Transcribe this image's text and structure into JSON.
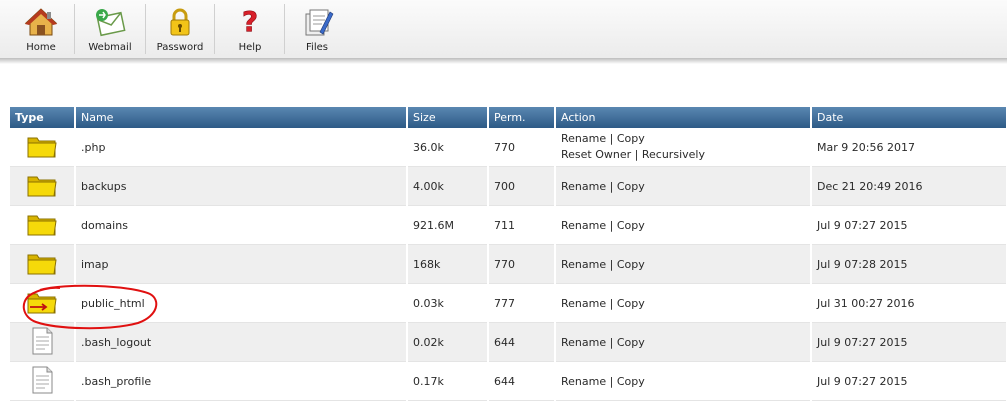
{
  "toolbar": {
    "buttons": [
      {
        "label": "Home",
        "icon": "home-icon"
      },
      {
        "label": "Webmail",
        "icon": "webmail-icon"
      },
      {
        "label": "Password",
        "icon": "lock-icon"
      },
      {
        "label": "Help",
        "icon": "help-icon"
      },
      {
        "label": "Files",
        "icon": "files-icon"
      }
    ]
  },
  "table": {
    "headers": {
      "type": "Type",
      "name": "Name",
      "size": "Size",
      "perm": "Perm.",
      "action": "Action",
      "date": "Date"
    },
    "actions": {
      "rename": "Rename",
      "copy": "Copy",
      "reset_owner": "Reset Owner",
      "recursively": "Recursively",
      "sep": "|"
    },
    "rows": [
      {
        "type": "folder",
        "name": ".php",
        "size": "36.0k",
        "perm": "770",
        "date": "Mar 9 20:56 2017",
        "reset_owner": true
      },
      {
        "type": "folder",
        "name": "backups",
        "size": "4.00k",
        "perm": "700",
        "date": "Dec 21 20:49 2016",
        "reset_owner": false
      },
      {
        "type": "folder",
        "name": "domains",
        "size": "921.6M",
        "perm": "711",
        "date": "Jul 9 07:27 2015",
        "reset_owner": false
      },
      {
        "type": "folder",
        "name": "imap",
        "size": "168k",
        "perm": "770",
        "date": "Jul 9 07:28 2015",
        "reset_owner": false
      },
      {
        "type": "folder-link",
        "name": "public_html",
        "size": "0.03k",
        "perm": "777",
        "date": "Jul 31 00:27 2016",
        "reset_owner": false
      },
      {
        "type": "file",
        "name": ".bash_logout",
        "size": "0.02k",
        "perm": "644",
        "date": "Jul 9 07:27 2015",
        "reset_owner": false
      },
      {
        "type": "file",
        "name": ".bash_profile",
        "size": "0.17k",
        "perm": "644",
        "date": "Jul 9 07:27 2015",
        "reset_owner": false
      }
    ]
  },
  "colors": {
    "header_top": "#5a87b1",
    "header_bottom": "#2d5a86",
    "row_alt": "#efefef",
    "folder": "#f5d90a",
    "callout": "#e01010"
  }
}
